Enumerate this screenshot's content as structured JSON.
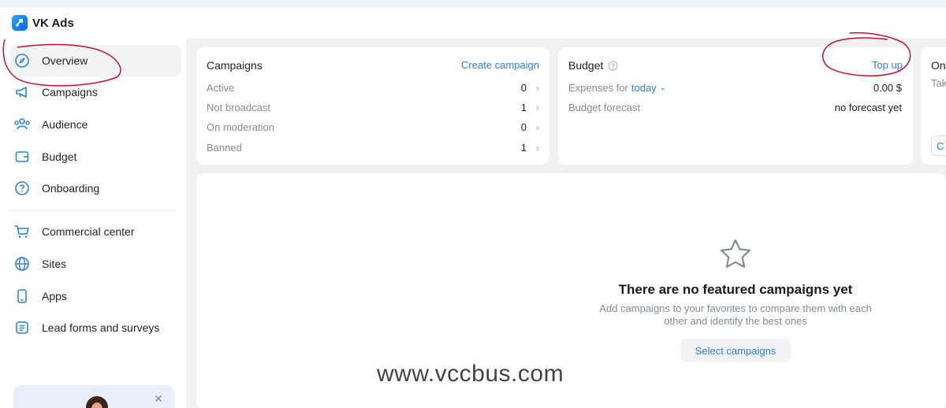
{
  "header": {
    "brand": "VK Ads"
  },
  "sidebar": {
    "items": [
      {
        "label": "Overview",
        "icon": "compass-icon",
        "active": true
      },
      {
        "label": "Campaigns",
        "icon": "megaphone-icon"
      },
      {
        "label": "Audience",
        "icon": "people-icon"
      },
      {
        "label": "Budget",
        "icon": "wallet-icon"
      },
      {
        "label": "Onboarding",
        "icon": "question-icon"
      },
      {
        "label": "Commercial center",
        "icon": "cart-icon"
      },
      {
        "label": "Sites",
        "icon": "globe-icon"
      },
      {
        "label": "Apps",
        "icon": "phone-icon"
      },
      {
        "label": "Lead forms and surveys",
        "icon": "list-icon"
      }
    ],
    "promo": {
      "close": "✕"
    }
  },
  "campaigns": {
    "title": "Campaigns",
    "create": "Create campaign",
    "rows": [
      {
        "label": "Active",
        "value": "0"
      },
      {
        "label": "Not broadcast",
        "value": "1"
      },
      {
        "label": "On moderation",
        "value": "0"
      },
      {
        "label": "Banned",
        "value": "1"
      }
    ]
  },
  "budget": {
    "title": "Budget",
    "topup": "Top up",
    "expenses_label": "Expenses for",
    "period": "today",
    "expenses_value": "0.00 $",
    "forecast_label": "Budget forecast",
    "forecast_value": "no forecast yet"
  },
  "onboarding_card": {
    "title": "On",
    "sub": "Tak",
    "btn": "C"
  },
  "empty": {
    "title": "There are no featured campaigns yet",
    "subtitle": "Add campaigns to your favorites to compare them with each other and identify the best ones",
    "button": "Select campaigns"
  },
  "watermark": "www.vccbus.com",
  "colors": {
    "accent": "#2d81e0",
    "annotation": "#c8102e"
  }
}
